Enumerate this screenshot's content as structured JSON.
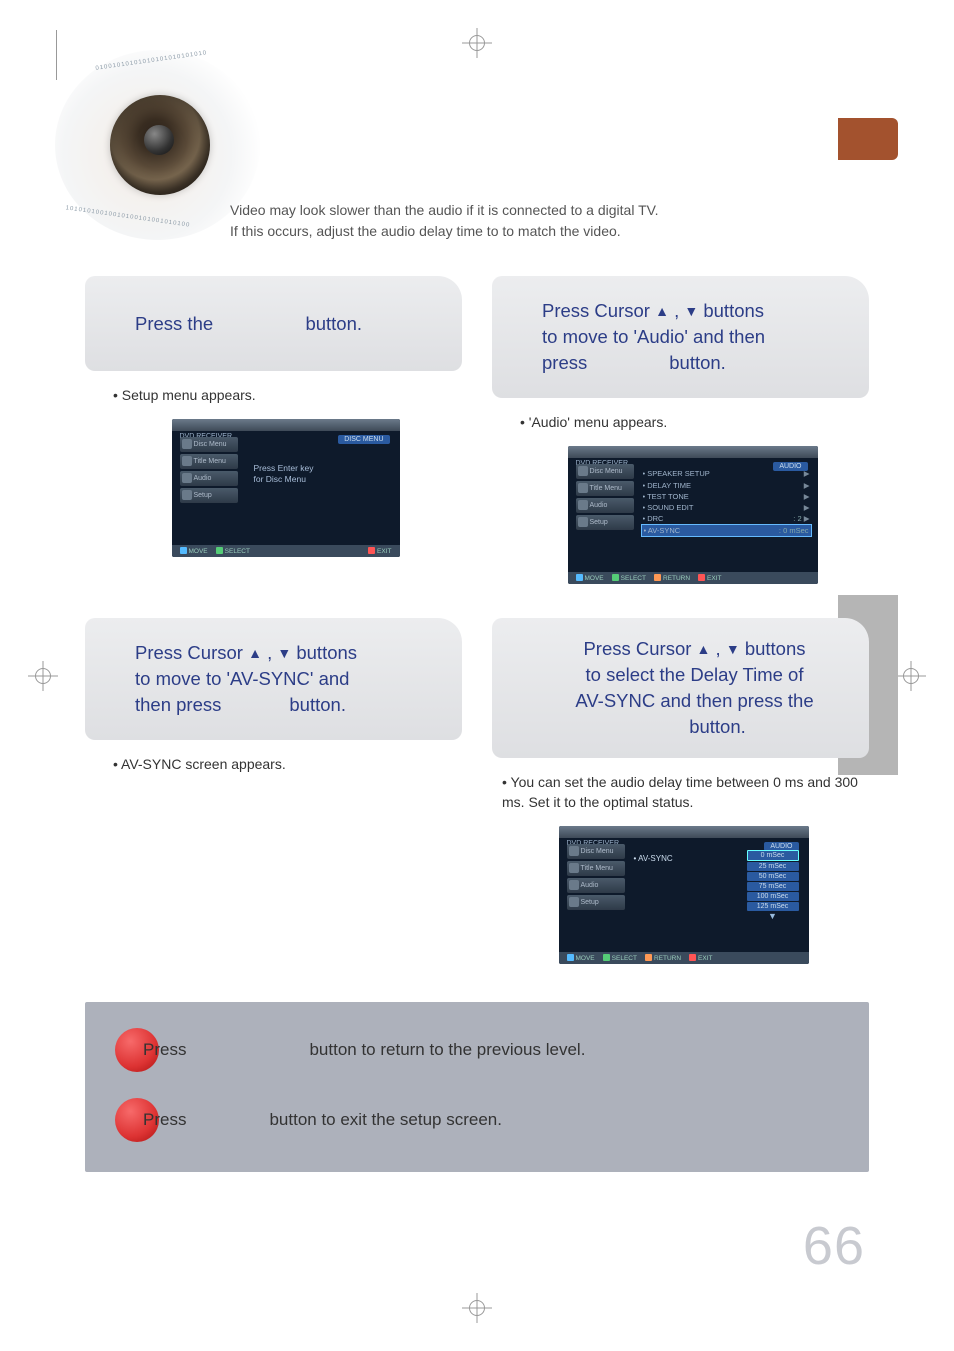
{
  "intro": {
    "line1": "Video may look slower than the audio if it is connected to a digital TV.",
    "line2": "If this occurs, adjust the audio delay time to to match the video."
  },
  "steps": {
    "s1": {
      "head": {
        "press_the": "Press the",
        "button_word": "button."
      },
      "body": {
        "bullet": "Setup menu appears."
      },
      "screenshot": {
        "header_tag": "DVD RECEIVER",
        "right_tag": "DISC MENU",
        "sidebar": [
          "Disc Menu",
          "Title Menu",
          "Audio",
          "Setup"
        ],
        "main_line1": "Press Enter key",
        "main_line2": "for Disc Menu",
        "footer": {
          "move": "MOVE",
          "select": "SELECT",
          "exit": "EXIT"
        }
      }
    },
    "s2": {
      "head": {
        "l1a": "Press Cursor ",
        "l1b": " , ",
        "l1c": " buttons",
        "l2": "to move to 'Audio' and then",
        "l3a": "press",
        "l3b": "button."
      },
      "body": {
        "bullet": "'Audio' menu appears."
      },
      "screenshot": {
        "header_tag": "DVD RECEIVER",
        "right_tag": "AUDIO",
        "sidebar": [
          "Disc Menu",
          "Title Menu",
          "Audio",
          "Setup"
        ],
        "rows": [
          {
            "lab": "SPEAKER SETUP",
            "arrow": true
          },
          {
            "lab": "DELAY TIME",
            "arrow": true
          },
          {
            "lab": "TEST TONE",
            "arrow": true
          },
          {
            "lab": "SOUND EDIT",
            "arrow": true
          },
          {
            "lab": "DRC",
            "val": ": 2",
            "arrow": true
          },
          {
            "lab": "AV-SYNC",
            "val": ": 0 mSec",
            "hl": true
          }
        ],
        "footer": {
          "move": "MOVE",
          "select": "SELECT",
          "return": "RETURN",
          "exit": "EXIT"
        }
      }
    },
    "s3": {
      "head": {
        "l1a": "Press Cursor ",
        "l1b": " , ",
        "l1c": "  buttons",
        "l2": "to move to 'AV-SYNC' and",
        "l3a": "then press",
        "l3b": "button."
      },
      "body": {
        "bullet": "AV-SYNC screen appears."
      }
    },
    "s4": {
      "head": {
        "l1a": "Press Cursor  ",
        "l1b": " , ",
        "l1c": "  buttons",
        "l2": "to select the Delay Time of",
        "l3": "AV-SYNC and then press the",
        "l4": "button."
      },
      "body": {
        "bullet": "You can set the audio delay time between 0 ms and 300 ms. Set it to the optimal status."
      },
      "screenshot": {
        "header_tag": "DVD RECEIVER",
        "right_tag": "AUDIO",
        "sidebar": [
          "Disc Menu",
          "Title Menu",
          "Audio",
          "Setup"
        ],
        "av_label": "AV-SYNC",
        "options": [
          "0 mSec",
          "25 mSec",
          "50 mSec",
          "75 mSec",
          "100 mSec",
          "125 mSec"
        ],
        "footer": {
          "move": "MOVE",
          "select": "SELECT",
          "return": "RETURN",
          "exit": "EXIT"
        }
      }
    }
  },
  "footer_panel": {
    "row1": {
      "press": "Press",
      "rest": "button to return to the previous level."
    },
    "row2": {
      "press": "Press",
      "rest": "button to exit the setup screen."
    }
  },
  "page_number": "66"
}
